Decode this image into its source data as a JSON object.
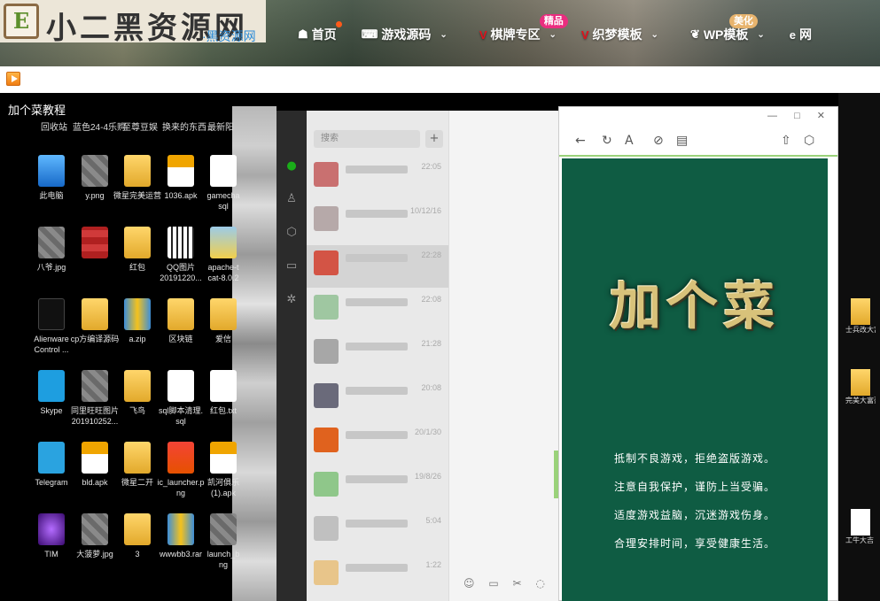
{
  "site": {
    "logo_text": "小二黑资源网",
    "logo_icon": "E",
    "logo_subtext": "·黑资源网"
  },
  "nav": [
    {
      "label": "首页",
      "icon": "home-icon",
      "glyph": "☗",
      "chevron": false,
      "dot": true
    },
    {
      "label": "游戏源码",
      "icon": "gamepad-icon",
      "glyph": "⌨",
      "chevron": true
    },
    {
      "label": "棋牌专区",
      "icon": "v-icon",
      "glyph": "V",
      "chevron": true,
      "badge": "精品"
    },
    {
      "label": "织梦模板",
      "icon": "v-icon",
      "glyph": "V",
      "chevron": true
    },
    {
      "label": "WP模板",
      "icon": "wordpress-icon",
      "glyph": "❦",
      "chevron": true,
      "badge": "美化"
    },
    {
      "label": "网",
      "icon": "ie-icon",
      "glyph": "e",
      "chevron": false
    }
  ],
  "video": {
    "title": "加个菜教程",
    "top_labels": [
      "回收站",
      "蓝色24-4乐购",
      "至尊豆娱",
      "换来的东西",
      "最新阳"
    ],
    "desktop_icons": [
      {
        "label": "此电脑",
        "icon": "pc-icon"
      },
      {
        "label": "y.png",
        "icon": "image-icon"
      },
      {
        "label": "微星完美运营",
        "icon": "folder-icon"
      },
      {
        "label": "1036.apk",
        "icon": "apk-icon"
      },
      {
        "label": "gamecha\nsql",
        "icon": "doc-icon"
      },
      {
        "label": "八爷.jpg",
        "icon": "image-icon"
      },
      {
        "label": "",
        "icon": "image-icon"
      },
      {
        "label": "红包",
        "icon": "folder-icon"
      },
      {
        "label": "QQ图片\n20191220...",
        "icon": "qr-icon"
      },
      {
        "label": "apache-t\ncat-8.0.2",
        "icon": "tomcat-icon"
      },
      {
        "label": "Alienware\nControl ...",
        "icon": "alienware-icon"
      },
      {
        "label": "cp方编译源码",
        "icon": "folder-icon"
      },
      {
        "label": "a.zip",
        "icon": "zip-icon"
      },
      {
        "label": "区块链",
        "icon": "folder-icon"
      },
      {
        "label": "爱信",
        "icon": "folder-icon"
      },
      {
        "label": "Skype",
        "icon": "skype-icon"
      },
      {
        "label": "同里旺旺图片\n201910252...",
        "icon": "image-icon"
      },
      {
        "label": "飞鸟",
        "icon": "folder-icon"
      },
      {
        "label": "sql脚本清理.\nsql",
        "icon": "doc-icon"
      },
      {
        "label": "红包.txt",
        "icon": "doc-icon"
      },
      {
        "label": "Telegram",
        "icon": "telegram-icon"
      },
      {
        "label": "bld.apk",
        "icon": "apk-icon"
      },
      {
        "label": "微星二开",
        "icon": "folder-icon"
      },
      {
        "label": "ic_launcher.p\nng",
        "icon": "app-icon"
      },
      {
        "label": "凯河俱乐\n(1).apk",
        "icon": "apk-icon"
      },
      {
        "label": "TIM",
        "icon": "tim-icon"
      },
      {
        "label": "大菠萝.jpg",
        "icon": "image-icon"
      },
      {
        "label": "3",
        "icon": "folder-icon"
      },
      {
        "label": "wwwbb3.rar",
        "icon": "rar-icon"
      },
      {
        "label": "launch_b\nng",
        "icon": "image-icon"
      }
    ],
    "right_icons": [
      {
        "label": "士兵改大富豪",
        "icon": "folder-icon"
      },
      {
        "label": "完美大富豪",
        "icon": "folder-icon"
      },
      {
        "label": "工牛大吉\n操作说...",
        "icon": "doc-icon"
      }
    ],
    "wechat": {
      "search_placeholder": "搜索",
      "plus": "+",
      "times": [
        "22:05",
        "10/12/16",
        "22:28",
        "22:08",
        "21:28",
        "20:08",
        "20/1/30",
        "19/8/26",
        "5:04",
        "1:22"
      ],
      "tool_icons": "☺ ▭ ✂ ◌"
    },
    "mini_window": {
      "controls": "— □ ✕",
      "toolbar": [
        "←",
        "↻",
        "A",
        "⊘",
        "▤",
        "⇧",
        "⬡"
      ],
      "title": "加个菜",
      "notices": [
        "抵制不良游戏，拒绝盗版游戏。",
        "注意自我保护，谨防上当受骗。",
        "适度游戏益脑，沉迷游戏伤身。",
        "合理安排时间，享受健康生活。"
      ]
    }
  },
  "colors": {
    "panel_green": "#0f5c43",
    "badge_pink": "#ea2d7f",
    "badge_tan": "#e8b46e",
    "accent_green": "#9ad27a"
  }
}
